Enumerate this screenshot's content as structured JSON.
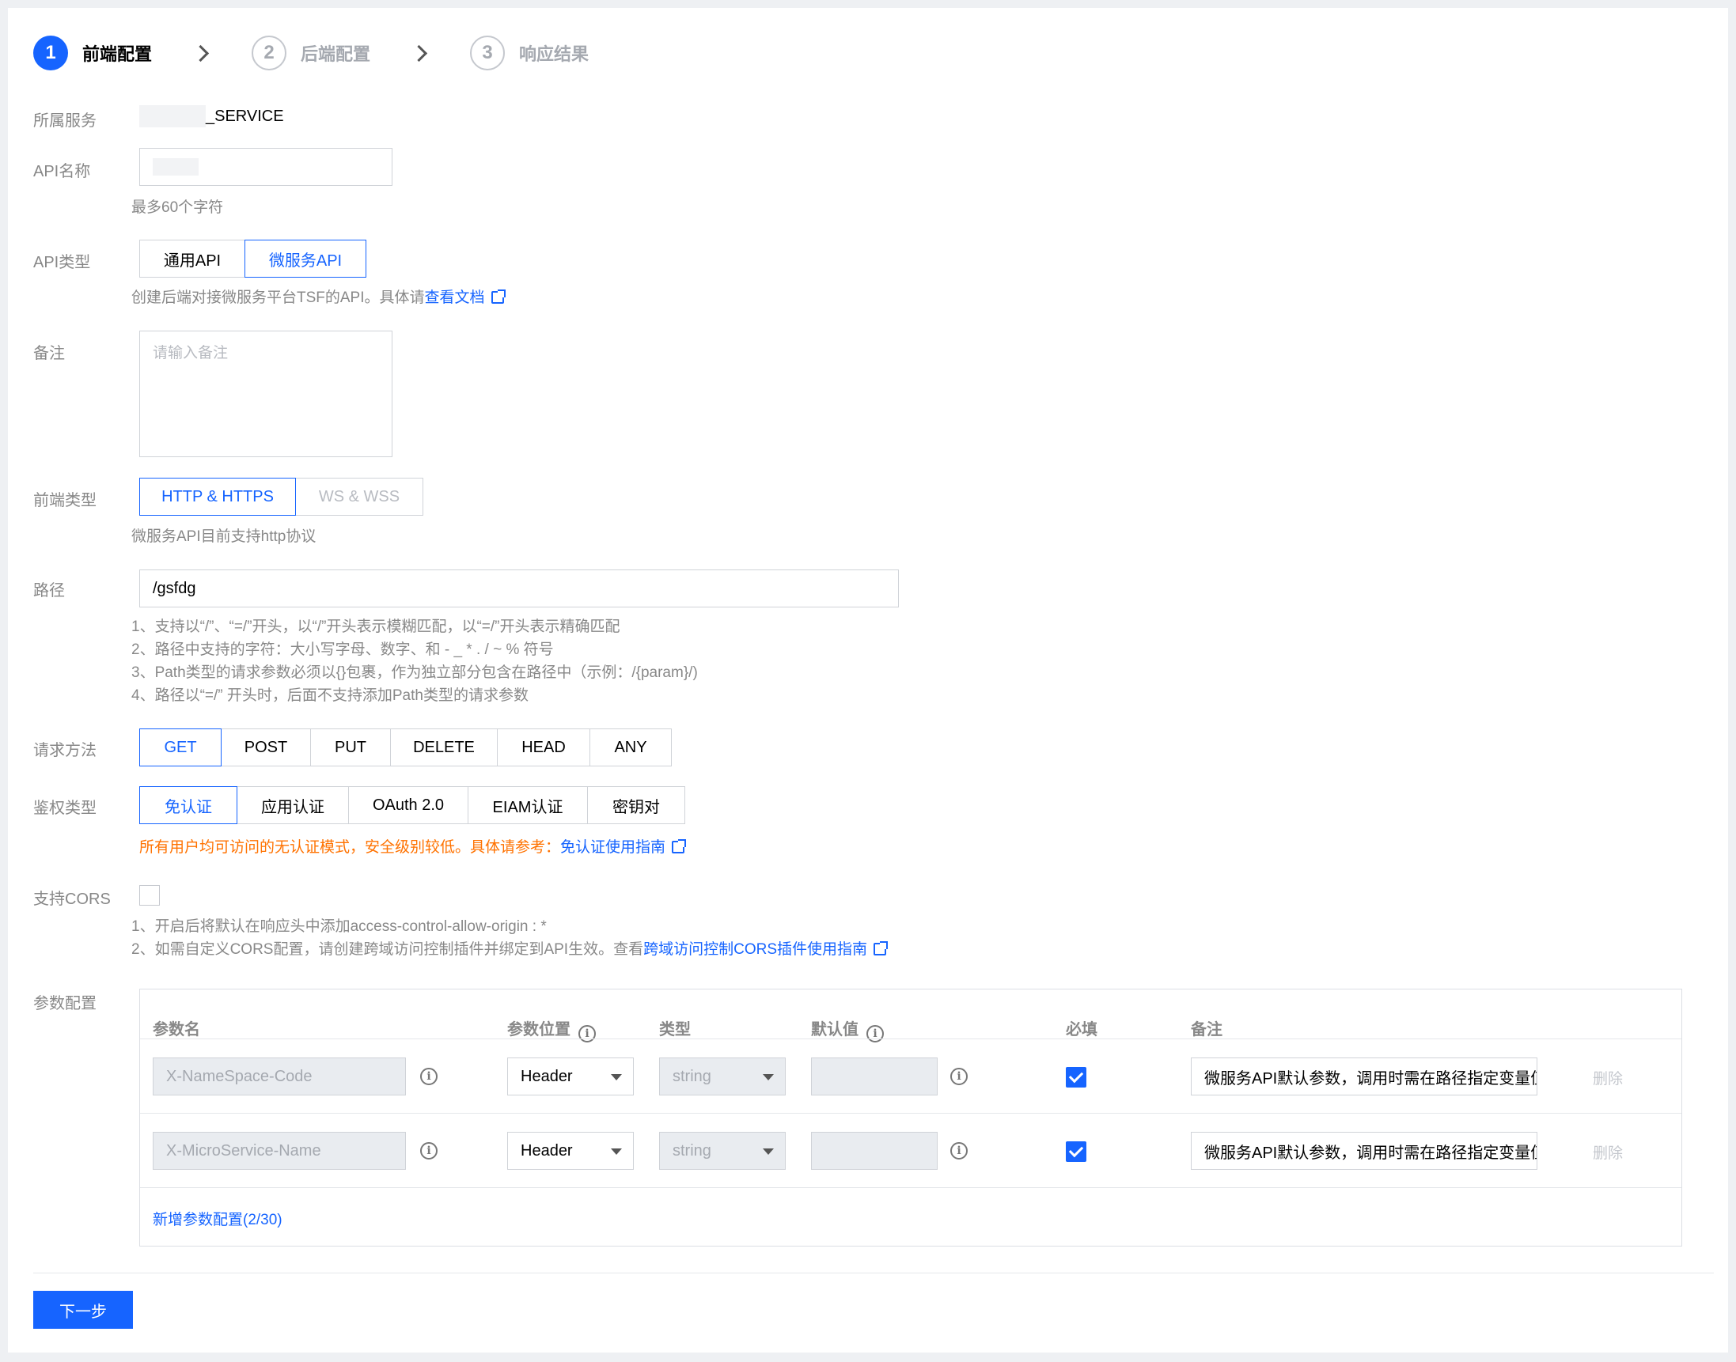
{
  "steps": [
    {
      "num": "1",
      "label": "前端配置"
    },
    {
      "num": "2",
      "label": "后端配置"
    },
    {
      "num": "3",
      "label": "响应结果"
    }
  ],
  "service": {
    "label": "所属服务",
    "value": "_SERVICE"
  },
  "api_name": {
    "label": "API名称",
    "hint": "最多60个字符"
  },
  "api_type": {
    "label": "API类型",
    "options": [
      "通用API",
      "微服务API"
    ],
    "selected": "微服务API",
    "hint_prefix": "创建后端对接微服务平台TSF的API。具体请",
    "hint_link": "查看文档"
  },
  "remark": {
    "label": "备注",
    "placeholder": "请输入备注"
  },
  "frontend_type": {
    "label": "前端类型",
    "options": [
      "HTTP & HTTPS",
      "WS & WSS"
    ],
    "selected": "HTTP & HTTPS",
    "hint": "微服务API目前支持http协议"
  },
  "path": {
    "label": "路径",
    "value": "/gsfdg",
    "hints": [
      "1、支持以“/”、“=/”开头，以“/”开头表示模糊匹配，以“=/”开头表示精确匹配",
      "2、路径中支持的字符：大小写字母、数字、和 - _ * . / ~ % 符号",
      "3、Path类型的请求参数必须以{}包裹，作为独立部分包含在路径中（示例：/{param}/)",
      "4、路径以“=/” 开头时，后面不支持添加Path类型的请求参数"
    ]
  },
  "method": {
    "label": "请求方法",
    "options": [
      "GET",
      "POST",
      "PUT",
      "DELETE",
      "HEAD",
      "ANY"
    ],
    "selected": "GET"
  },
  "auth": {
    "label": "鉴权类型",
    "options": [
      "免认证",
      "应用认证",
      "OAuth 2.0",
      "EIAM认证",
      "密钥对"
    ],
    "selected": "免认证",
    "warning": "所有用户均可访问的无认证模式，安全级别较低。具体请参考：",
    "warning_link": "免认证使用指南"
  },
  "cors": {
    "label": "支持CORS",
    "checked": false,
    "hint1": "1、开启后将默认在响应头中添加access-control-allow-origin : *",
    "hint2_prefix": "2、如需自定义CORS配置，请创建跨域访问控制插件并绑定到API生效。查看",
    "hint2_link": "跨域访问控制CORS插件使用指南"
  },
  "params": {
    "label": "参数配置",
    "headers": {
      "name": "参数名",
      "position": "参数位置",
      "type": "类型",
      "default": "默认值",
      "required": "必填",
      "remark": "备注"
    },
    "rows": [
      {
        "name": "X-NameSpace-Code",
        "position": "Header",
        "type": "string",
        "default": "",
        "required": true,
        "remark": "微服务API默认参数，调用时需在路径指定变量值",
        "delete": "删除"
      },
      {
        "name": "X-MicroService-Name",
        "position": "Header",
        "type": "string",
        "default": "",
        "required": true,
        "remark": "微服务API默认参数，调用时需在路径指定变量值",
        "delete": "删除"
      }
    ],
    "add_link": "新增参数配置(2/30)"
  },
  "next_button": "下一步",
  "colors": {
    "primary": "#1664ff",
    "warning": "#ff7200"
  }
}
